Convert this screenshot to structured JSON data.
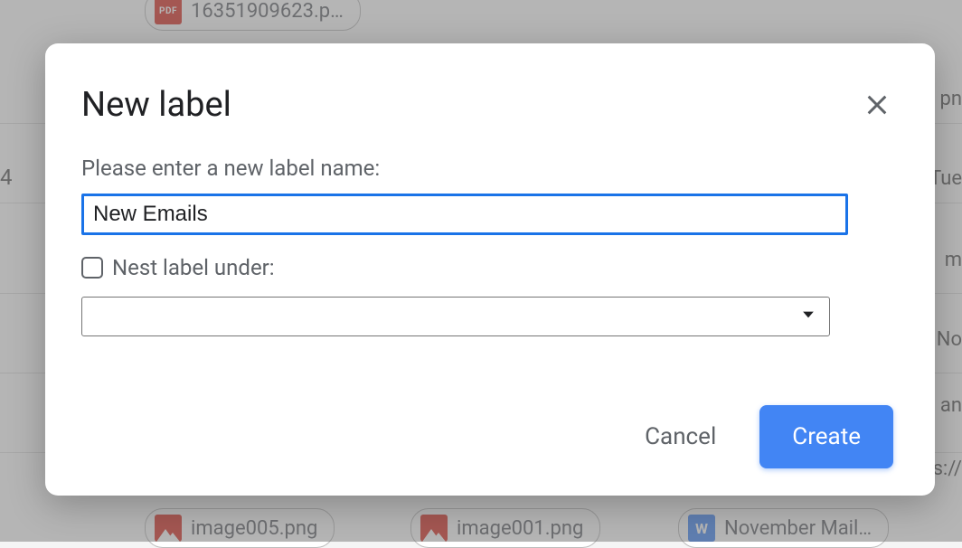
{
  "background": {
    "pdf_chip": "16351909623.p…",
    "row_right_1": "pn",
    "row_right_2": "Tue",
    "row_right_3": "m",
    "row_right_4": "No",
    "row_right_5": "an",
    "row_right_6": "s://",
    "left_4": "4",
    "chip_img1": "image005.png",
    "chip_img2": "image001.png",
    "chip_word": "November Mail…"
  },
  "dialog": {
    "title": "New label",
    "prompt": "Please enter a new label name:",
    "input_value": "New Emails",
    "nest_checkbox_label": "Nest label under:",
    "select_value": "",
    "cancel_label": "Cancel",
    "create_label": "Create"
  }
}
